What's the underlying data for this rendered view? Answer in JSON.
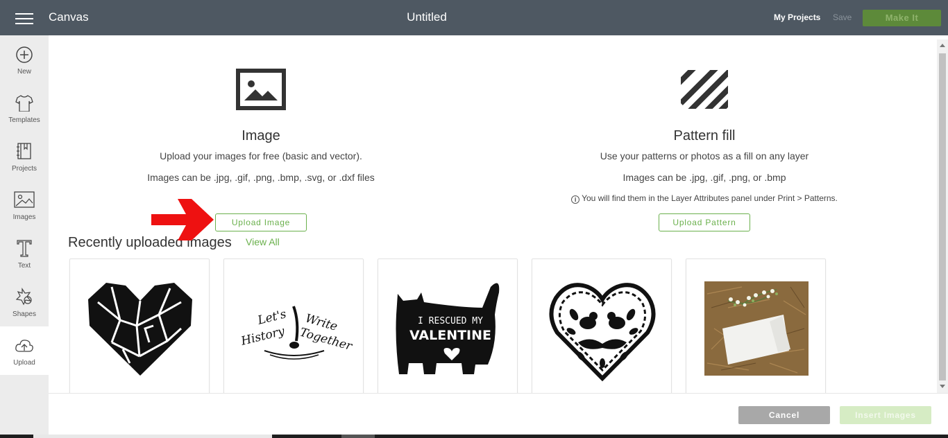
{
  "header": {
    "app_title": "Canvas",
    "doc_title": "Untitled",
    "my_projects": "My Projects",
    "save": "Save",
    "make_it": "Make It"
  },
  "sidebar": {
    "items": [
      {
        "label": "New",
        "icon": "plus-circle-icon"
      },
      {
        "label": "Templates",
        "icon": "tshirt-icon"
      },
      {
        "label": "Projects",
        "icon": "notebook-icon"
      },
      {
        "label": "Images",
        "icon": "image-icon"
      },
      {
        "label": "Text",
        "icon": "text-icon"
      },
      {
        "label": "Shapes",
        "icon": "shapes-icon"
      },
      {
        "label": "Upload",
        "icon": "upload-cloud-icon",
        "active": true
      }
    ]
  },
  "image_section": {
    "icon": "image-icon",
    "title": "Image",
    "desc": "Upload your images for free (basic and vector).",
    "formats": "Images can be .jpg, .gif, .png, .bmp, .svg, or .dxf files",
    "button": "Upload Image"
  },
  "pattern_section": {
    "icon": "diagonal-stripes-icon",
    "title": "Pattern fill",
    "desc": "Use your patterns or photos as a fill on any layer",
    "formats": "Images can be .jpg, .gif, .png, or .bmp",
    "note": "You will find them in the Layer Attributes panel under Print > Patterns.",
    "button": "Upload Pattern"
  },
  "recent": {
    "title": "Recently uploaded images",
    "view_all": "View All",
    "thumbnails": [
      {
        "name": "geometric-heart",
        "text": ""
      },
      {
        "name": "lets-write-history-together",
        "text_line1": "Let's",
        "text_line2": "Write",
        "text_line3": "History",
        "text_line4": "Together"
      },
      {
        "name": "rescued-my-valentine-cat",
        "text_line1": "I RESCUED MY",
        "text_line2": "VALENTINE"
      },
      {
        "name": "floral-heart-birds",
        "text": ""
      },
      {
        "name": "flowers-on-straw-photo",
        "text": ""
      }
    ]
  },
  "footer": {
    "cancel": "Cancel",
    "insert": "Insert Images"
  },
  "colors": {
    "topbar": "#4e5862",
    "accent_green": "#6ab04c",
    "make_it_bg": "#5d8a3a",
    "arrow_red": "#ee1111"
  }
}
